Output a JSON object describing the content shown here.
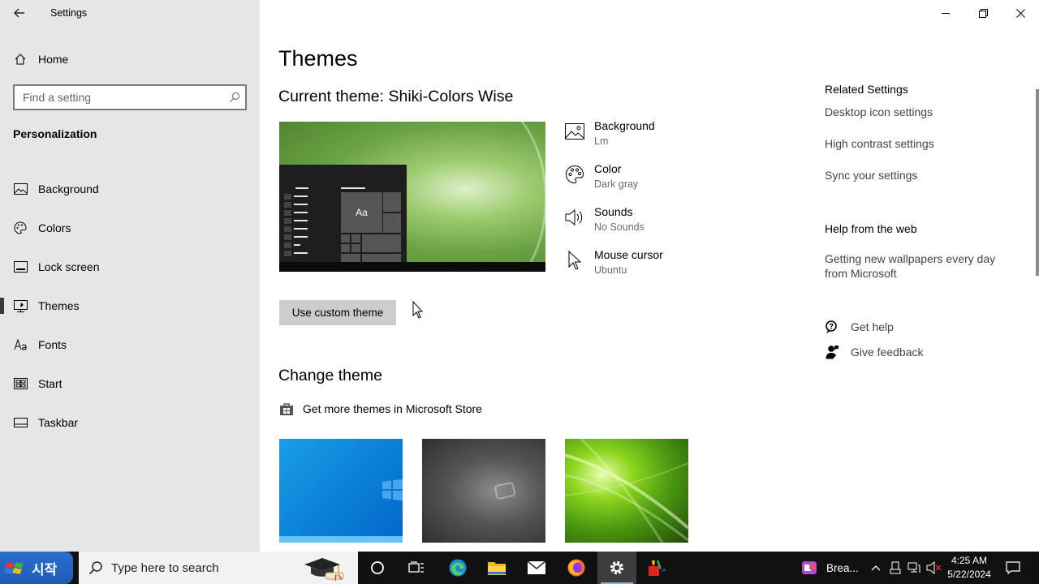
{
  "window": {
    "title": "Settings",
    "controls": {
      "minimize": "minimize-icon",
      "restore": "restore-icon",
      "close": "close-icon"
    }
  },
  "sidebar": {
    "home_label": "Home",
    "search_placeholder": "Find a setting",
    "section_title": "Personalization",
    "items": [
      {
        "label": "Background",
        "icon": "picture-icon"
      },
      {
        "label": "Colors",
        "icon": "palette-icon"
      },
      {
        "label": "Lock screen",
        "icon": "lock-screen-icon"
      },
      {
        "label": "Themes",
        "icon": "themes-icon",
        "active": true
      },
      {
        "label": "Fonts",
        "icon": "fonts-icon"
      },
      {
        "label": "Start",
        "icon": "start-icon"
      },
      {
        "label": "Taskbar",
        "icon": "taskbar-icon"
      }
    ]
  },
  "main": {
    "title": "Themes",
    "current_theme": "Current theme: Shiki-Colors Wise",
    "preview_sample": "Aa",
    "properties": [
      {
        "name": "Background",
        "value": "Lm",
        "icon": "picture-icon"
      },
      {
        "name": "Color",
        "value": "Dark gray",
        "icon": "palette-icon"
      },
      {
        "name": "Sounds",
        "value": "No Sounds",
        "icon": "speaker-icon"
      },
      {
        "name": "Mouse cursor",
        "value": "Ubuntu",
        "icon": "cursor-icon"
      }
    ],
    "custom_button": "Use custom theme",
    "change_title": "Change theme",
    "store_link": "Get more themes in Microsoft Store"
  },
  "related": {
    "heading": "Related Settings",
    "links": [
      "Desktop icon settings",
      "High contrast settings",
      "Sync your settings"
    ],
    "help_heading": "Help from the web",
    "help_link": "Getting new wallpapers every day from Microsoft",
    "get_help": "Get help",
    "give_feedback": "Give feedback"
  },
  "taskbar": {
    "start_label": "시작",
    "search_placeholder": "Type here to search",
    "pinned": [
      "cortana-icon",
      "task-view-icon",
      "edge-icon",
      "file-explorer-icon",
      "mail-icon",
      "firefox-icon",
      "settings-icon",
      "paint-icon"
    ],
    "tray_app_label": "Brea...",
    "time": "4:25 AM",
    "date": "5/22/2024"
  },
  "colors": {
    "sidebar_bg": "#e6e6e6",
    "taskbar_bg": "#111111",
    "start_blue": "#1f5bb5",
    "button_gray": "#cccccc"
  }
}
